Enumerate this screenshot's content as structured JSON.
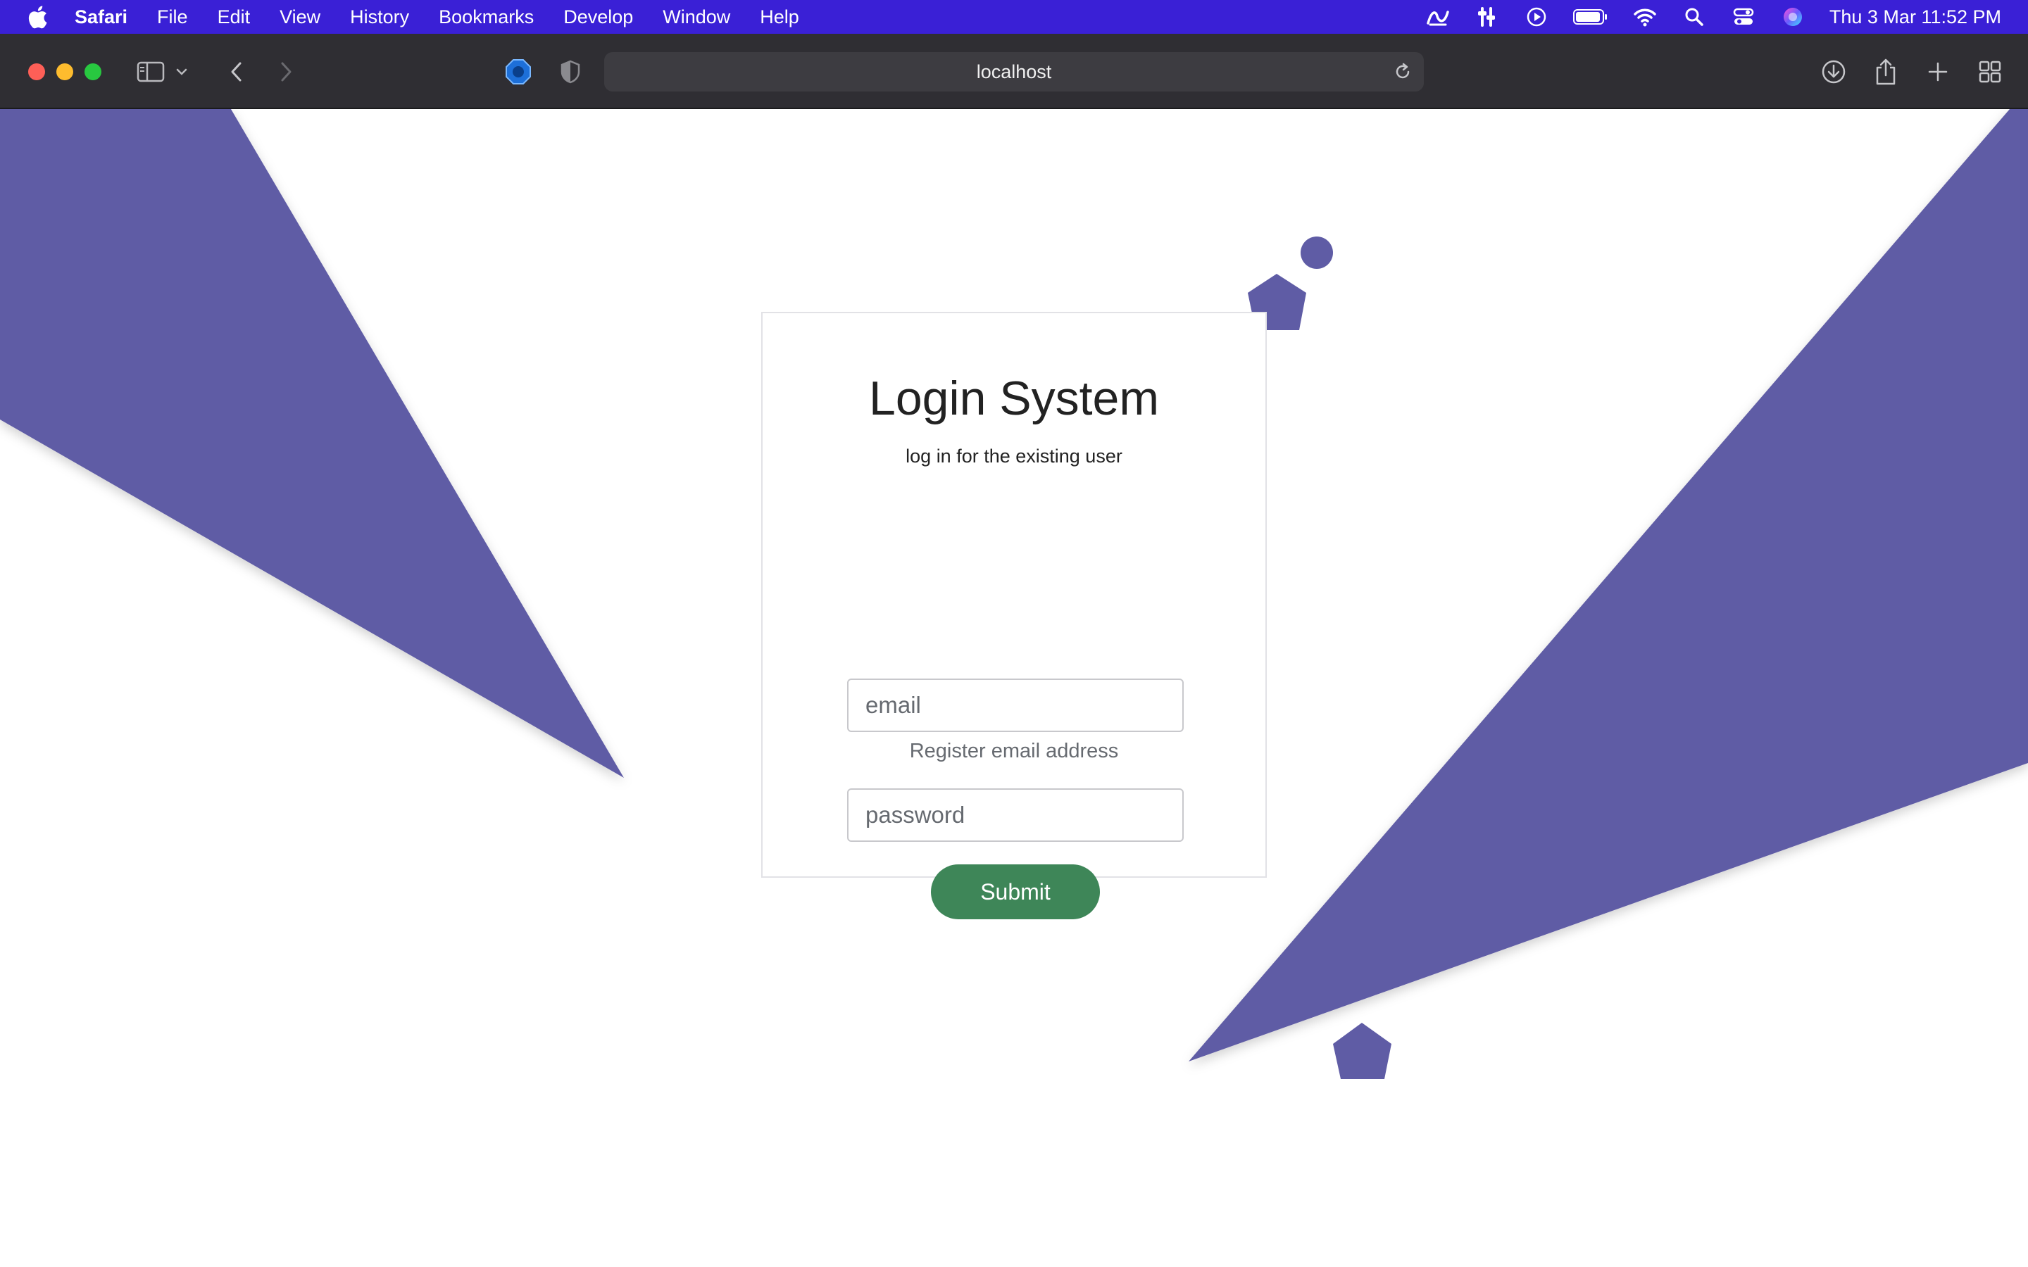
{
  "menubar": {
    "app_name": "Safari",
    "items": [
      "File",
      "Edit",
      "View",
      "History",
      "Bookmarks",
      "Develop",
      "Window",
      "Help"
    ],
    "clock": "Thu 3 Mar  11:52 PM",
    "status_icons": [
      "script-icon",
      "tools-icon",
      "play-icon",
      "battery-icon",
      "wifi-icon",
      "search-icon",
      "control-center-icon",
      "siri-icon"
    ]
  },
  "browser": {
    "url": "localhost"
  },
  "page": {
    "title": "Login System",
    "subtitle": "log in for the existing user",
    "email_placeholder": "email",
    "email_helper": "Register email address",
    "password_placeholder": "password",
    "submit_label": "Submit"
  },
  "colors": {
    "menubar_bg": "#3a20d6",
    "toolbar_bg": "#2f2e33",
    "shape_fill": "#5f5ca5",
    "submit_bg": "#3e8658"
  }
}
